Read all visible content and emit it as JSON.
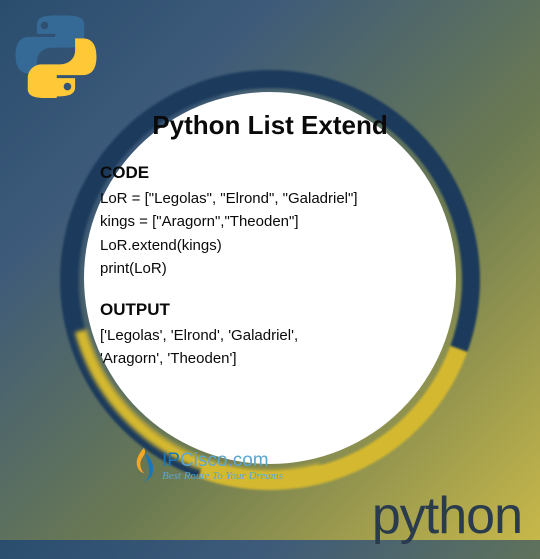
{
  "title": "Python List Extend",
  "code": {
    "label": "CODE",
    "lines": [
      "LoR = [\"Legolas\", \"Elrond\", \"Galadriel\"]",
      "kings = [\"Aragorn\",\"Theoden\"]",
      "LoR.extend(kings)",
      "print(LoR)"
    ]
  },
  "output": {
    "label": "OUTPUT",
    "lines": [
      "['Legolas', 'Elrond', 'Galadriel',",
      "'Aragorn', 'Theoden']"
    ]
  },
  "footer": {
    "site": {
      "prefix": "IP",
      "rest": "Cisco.com"
    },
    "tagline": "Best Route To Your Dreams"
  },
  "wordmark": "python"
}
